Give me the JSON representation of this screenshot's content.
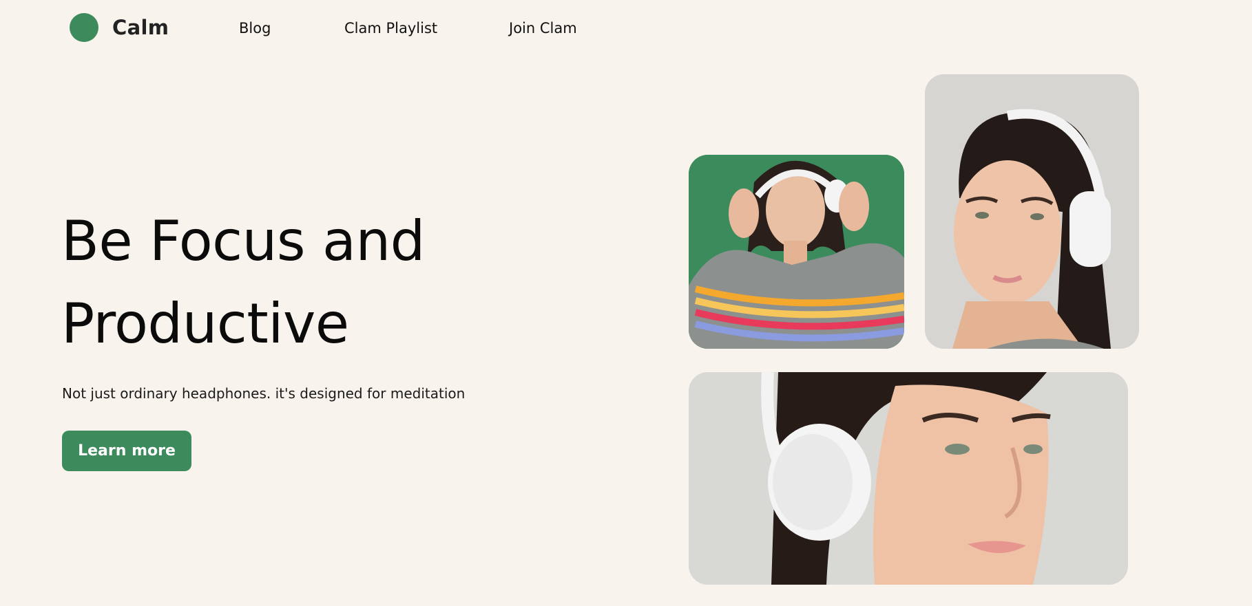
{
  "brand": {
    "name": "Calm",
    "color": "#3d8a5c"
  },
  "nav": {
    "items": [
      {
        "label": "Blog"
      },
      {
        "label": "Clam Playlist"
      },
      {
        "label": "Join Clam"
      }
    ]
  },
  "hero": {
    "title_line1": "Be Focus and",
    "title_line2": "Productive",
    "subtitle": "Not just ordinary headphones. it's designed for meditation",
    "cta_label": "Learn more"
  },
  "gallery": {
    "images": [
      {
        "subject": "woman-with-white-headphones-green-background"
      },
      {
        "subject": "woman-with-white-headphones-grey-background"
      },
      {
        "subject": "woman-face-closeup-with-white-headphones"
      }
    ]
  },
  "colors": {
    "background": "#f8f3ec",
    "accent": "#3d8a5c",
    "text": "#111111"
  }
}
